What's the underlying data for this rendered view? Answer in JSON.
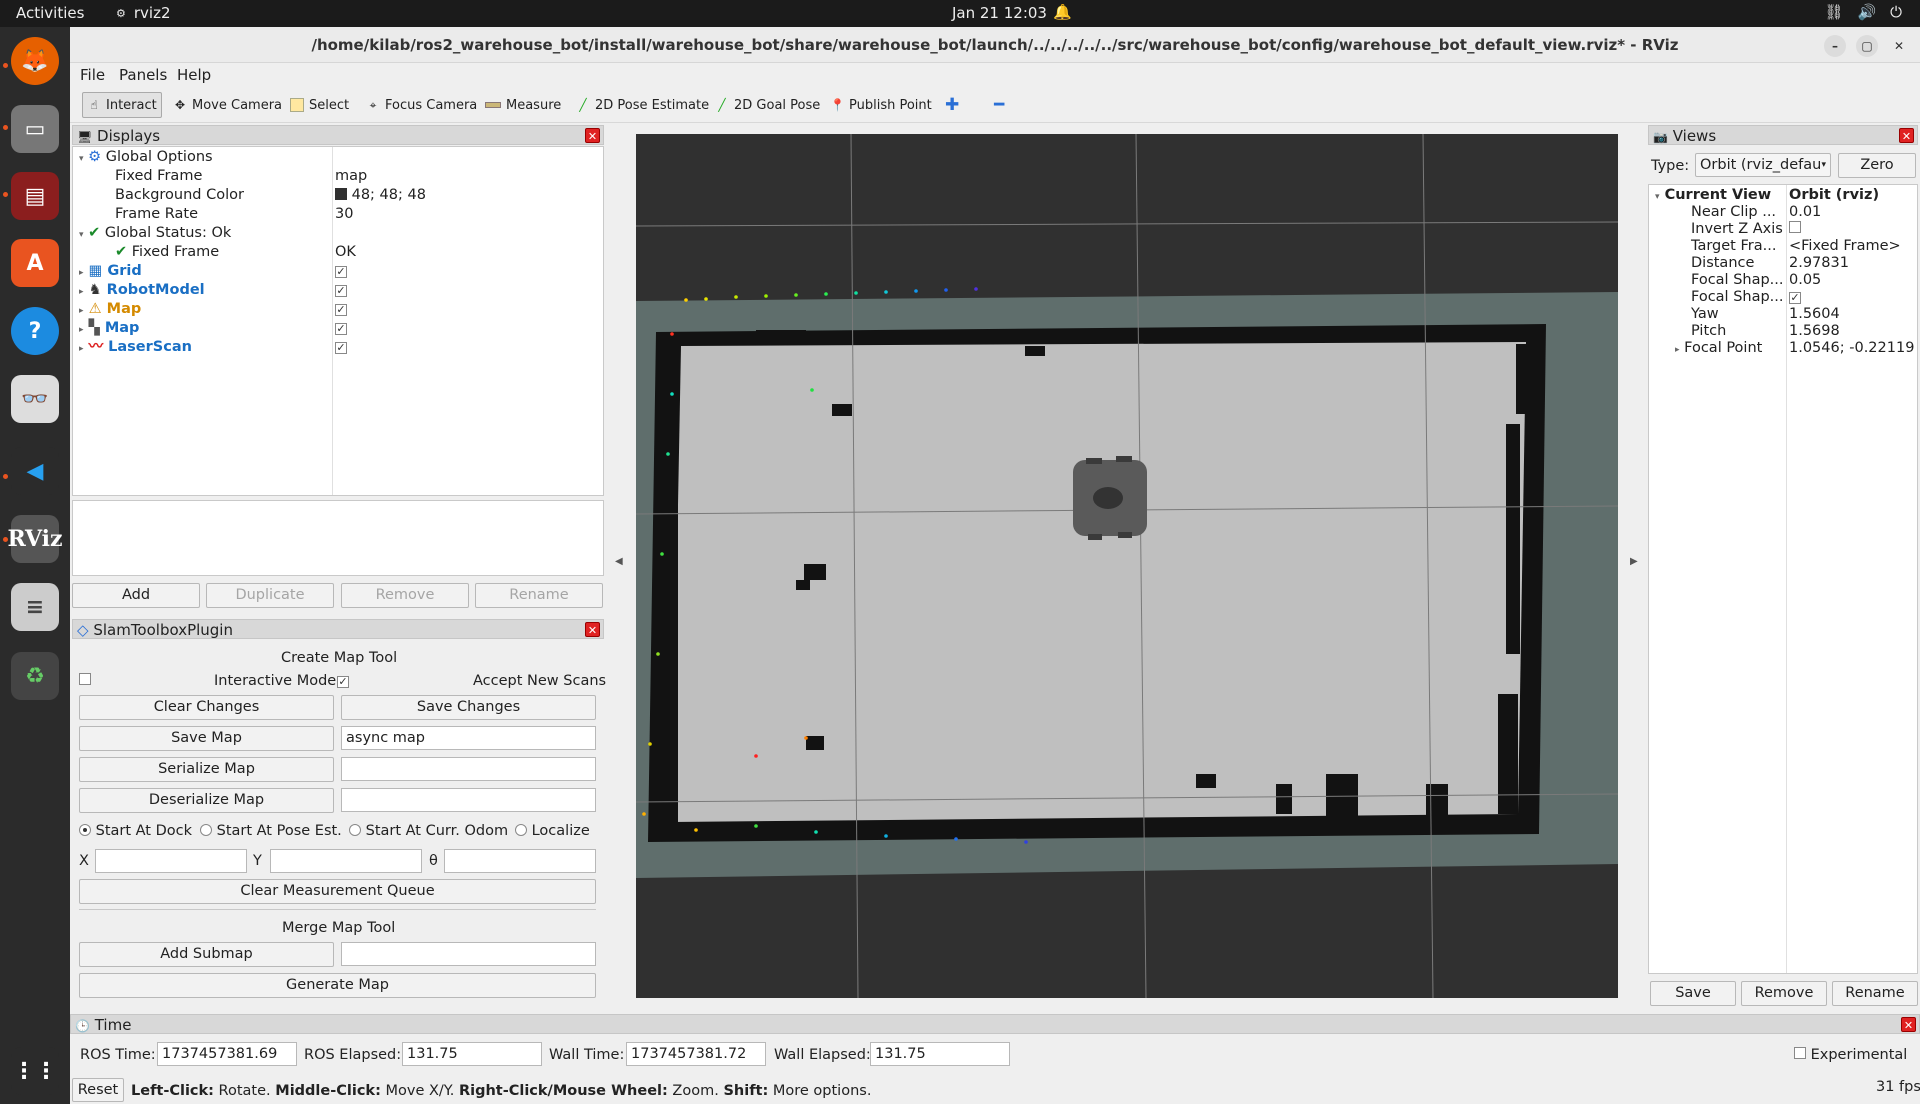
{
  "topbar": {
    "activities": "Activities",
    "app_name": "rviz2",
    "clock": "Jan 21  12:03"
  },
  "window": {
    "title": "/home/kilab/ros2_warehouse_bot/install/warehouse_bot/share/warehouse_bot/launch/../../../../../src/warehouse_bot/config/warehouse_bot_default_view.rviz* - RViz"
  },
  "menu": [
    "File",
    "Panels",
    "Help"
  ],
  "toolbar": {
    "interact": "Interact",
    "move_camera": "Move Camera",
    "select": "Select",
    "focus_camera": "Focus Camera",
    "measure": "Measure",
    "pose_estimate": "2D Pose Estimate",
    "goal_pose": "2D Goal Pose",
    "publish_point": "Publish Point"
  },
  "displays": {
    "title": "Displays",
    "rows": [
      {
        "label": "Global Options",
        "value": ""
      },
      {
        "label": "Fixed Frame",
        "value": "map"
      },
      {
        "label": "Background Color",
        "value": "48; 48; 48"
      },
      {
        "label": "Frame Rate",
        "value": "30"
      },
      {
        "label": "Global Status: Ok",
        "value": ""
      },
      {
        "label": "Fixed Frame",
        "value": "OK"
      },
      {
        "label": "Grid",
        "value": ""
      },
      {
        "label": "RobotModel",
        "value": ""
      },
      {
        "label": "Map",
        "value": ""
      },
      {
        "label": "Map",
        "value": ""
      },
      {
        "label": "LaserScan",
        "value": ""
      }
    ],
    "buttons": {
      "add": "Add",
      "duplicate": "Duplicate",
      "remove": "Remove",
      "rename": "Rename"
    },
    "colors": {
      "Grid": "#1a6fc4",
      "RobotModel": "#1a6fc4",
      "Map_warn": "#d48a00",
      "Map": "#1a6fc4",
      "LaserScan": "#1a6fc4"
    }
  },
  "slam": {
    "title": "SlamToolboxPlugin",
    "create_title": "Create Map Tool",
    "interactive_mode": "Interactive Mode",
    "accept_new_scans": "Accept New Scans",
    "clear_changes": "Clear Changes",
    "save_changes": "Save Changes",
    "save_map": "Save Map",
    "save_map_value": "async map",
    "serialize_map": "Serialize Map",
    "deserialize_map": "Deserialize Map",
    "start_at_dock": "Start At Dock",
    "start_at_pose": "Start At Pose Est.",
    "start_at_odom": "Start At Curr. Odom",
    "localize": "Localize",
    "x_label": "X",
    "y_label": "Y",
    "theta_label": "θ",
    "clear_queue": "Clear Measurement Queue",
    "merge_title": "Merge Map Tool",
    "add_submap": "Add Submap",
    "generate_map": "Generate Map"
  },
  "views": {
    "title": "Views",
    "type_label": "Type:",
    "type_value": "Orbit (rviz_defau",
    "zero": "Zero",
    "rows": [
      {
        "label": "Current View",
        "value": "Orbit (rviz)"
      },
      {
        "label": "Near Clip ...",
        "value": "0.01"
      },
      {
        "label": "Invert Z Axis",
        "value": ""
      },
      {
        "label": "Target Fra...",
        "value": "<Fixed Frame>"
      },
      {
        "label": "Distance",
        "value": "2.97831"
      },
      {
        "label": "Focal Shap...",
        "value": "0.05"
      },
      {
        "label": "Focal Shap...",
        "value": ""
      },
      {
        "label": "Yaw",
        "value": "1.5604"
      },
      {
        "label": "Pitch",
        "value": "1.5698"
      },
      {
        "label": "Focal Point",
        "value": "1.0546; -0.22119..."
      }
    ],
    "save": "Save",
    "remove": "Remove",
    "rename": "Rename"
  },
  "time": {
    "title": "Time",
    "ros_time_label": "ROS Time:",
    "ros_time": "1737457381.69",
    "ros_elapsed_label": "ROS Elapsed:",
    "ros_elapsed": "131.75",
    "wall_time_label": "Wall Time:",
    "wall_time": "1737457381.72",
    "wall_elapsed_label": "Wall Elapsed:",
    "wall_elapsed": "131.75",
    "experimental": "Experimental"
  },
  "status": {
    "reset": "Reset",
    "left_click": "Left-Click:",
    "left_click_desc": " Rotate. ",
    "middle_click": "Middle-Click:",
    "middle_click_desc": " Move X/Y. ",
    "right_click": "Right-Click/Mouse Wheel:",
    "right_click_desc": " Zoom. ",
    "shift": "Shift:",
    "shift_desc": " More options.",
    "fps": "31 fps"
  }
}
